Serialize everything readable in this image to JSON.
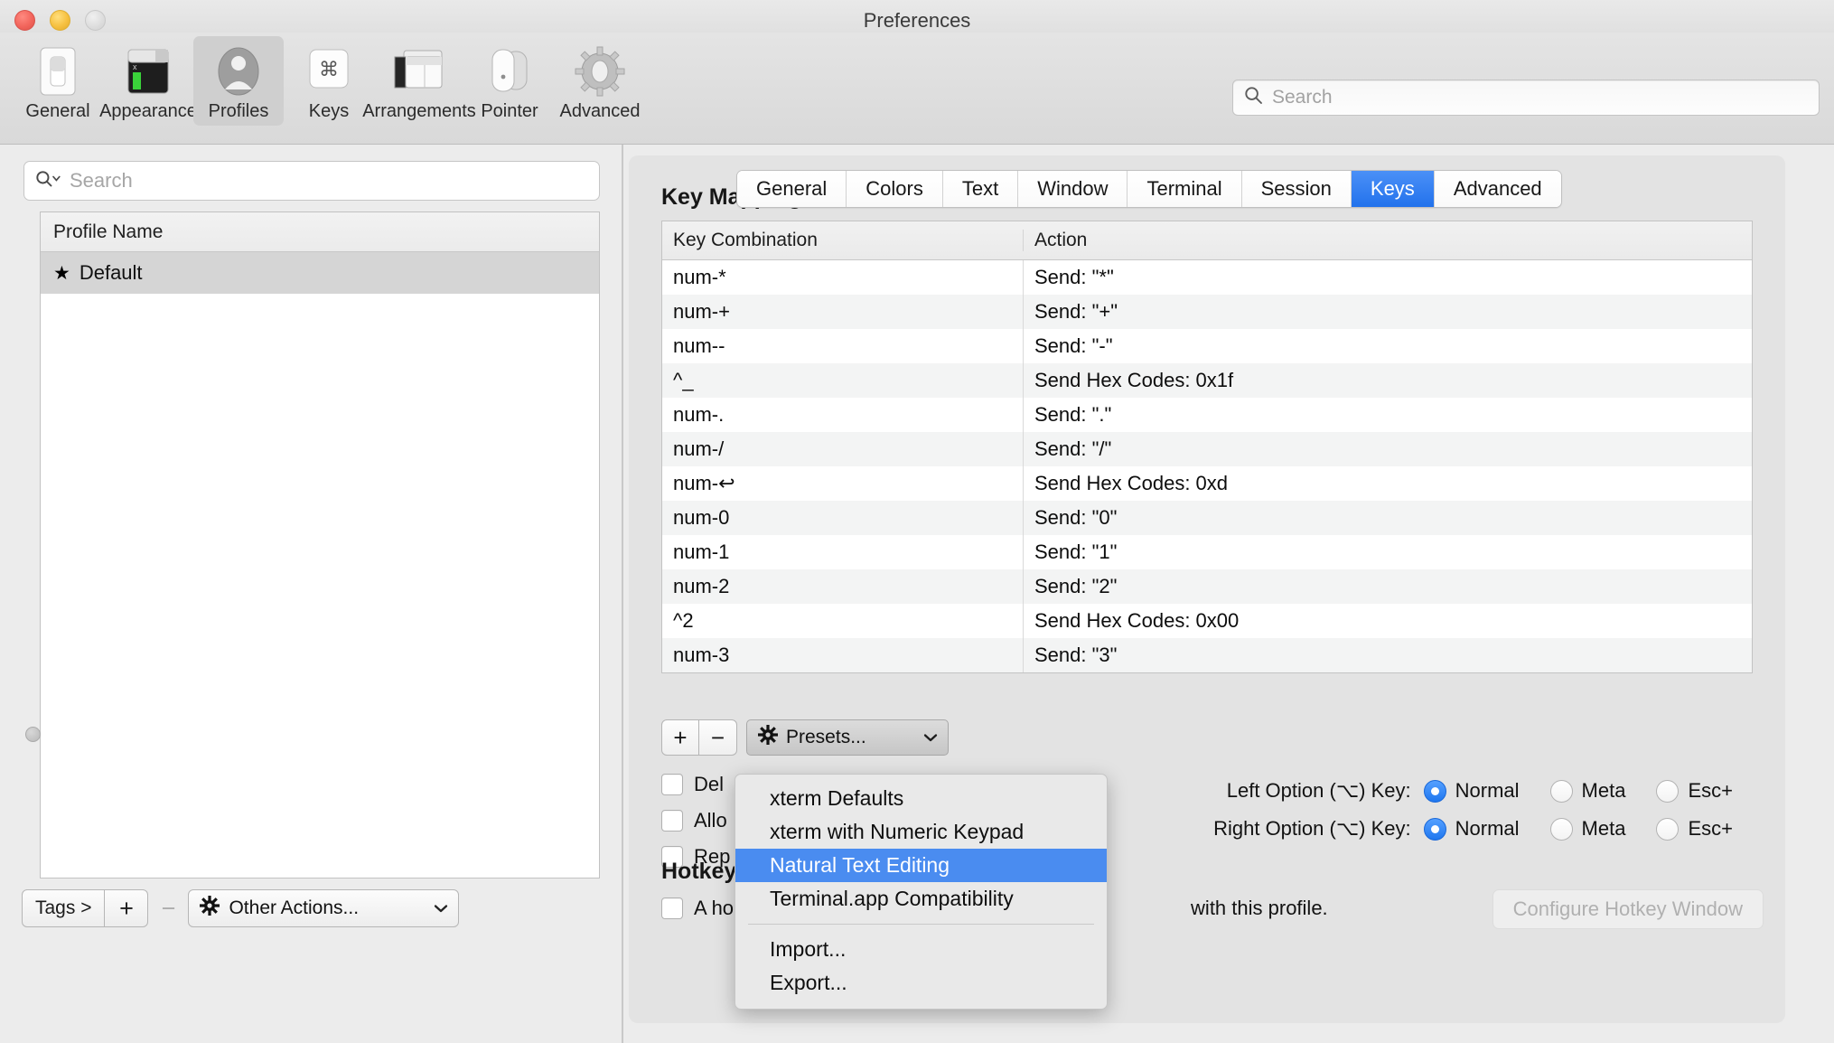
{
  "window": {
    "title": "Preferences",
    "traffic_lights": [
      "close-button",
      "minimize-button",
      "zoom-button"
    ]
  },
  "toolbar": {
    "items": [
      {
        "label": "General",
        "icon": "general-icon",
        "selected": false
      },
      {
        "label": "Appearance",
        "icon": "appearance-icon",
        "selected": false
      },
      {
        "label": "Profiles",
        "icon": "profiles-icon",
        "selected": true
      },
      {
        "label": "Keys",
        "icon": "keys-icon",
        "selected": false
      },
      {
        "label": "Arrangements",
        "icon": "arrangements-icon",
        "selected": false
      },
      {
        "label": "Pointer",
        "icon": "pointer-icon",
        "selected": false
      },
      {
        "label": "Advanced",
        "icon": "advanced-icon",
        "selected": false
      }
    ],
    "search": {
      "placeholder": "Search",
      "value": "",
      "icon": "search-icon"
    }
  },
  "sidebar": {
    "search": {
      "placeholder": "Search",
      "value": "",
      "icon": "search-scope-icon"
    },
    "table": {
      "header": "Profile Name",
      "rows": [
        {
          "name": "Default",
          "starred": true,
          "selected": true
        }
      ]
    },
    "bottom_bar": {
      "tags_label": "Tags >",
      "add_label": "+",
      "remove_label": "−",
      "other_actions_label": "Other Actions...",
      "gear_icon": "gear-icon",
      "chevron_icon": "chevron-down-icon"
    }
  },
  "tabs": [
    {
      "label": "General",
      "selected": false
    },
    {
      "label": "Colors",
      "selected": false
    },
    {
      "label": "Text",
      "selected": false
    },
    {
      "label": "Window",
      "selected": false
    },
    {
      "label": "Terminal",
      "selected": false
    },
    {
      "label": "Session",
      "selected": false
    },
    {
      "label": "Keys",
      "selected": true
    },
    {
      "label": "Advanced",
      "selected": false
    }
  ],
  "keys_pane": {
    "section_title": "Key Mappings",
    "table": {
      "columns": [
        "Key Combination",
        "Action"
      ],
      "rows": [
        {
          "combo": "num-*",
          "action": "Send: \"*\""
        },
        {
          "combo": "num-+",
          "action": "Send: \"+\""
        },
        {
          "combo": "num--",
          "action": "Send: \"-\""
        },
        {
          "combo": "^_",
          "action": "Send Hex Codes: 0x1f"
        },
        {
          "combo": "num-.",
          "action": "Send: \".\""
        },
        {
          "combo": "num-/",
          "action": "Send: \"/\""
        },
        {
          "combo": "num-↩",
          "action": "Send Hex Codes: 0xd"
        },
        {
          "combo": "num-0",
          "action": "Send: \"0\""
        },
        {
          "combo": "num-1",
          "action": "Send: \"1\""
        },
        {
          "combo": "num-2",
          "action": "Send: \"2\""
        },
        {
          "combo": "^2",
          "action": "Send Hex Codes: 0x00"
        },
        {
          "combo": "num-3",
          "action": "Send: \"3\""
        }
      ]
    },
    "tools": {
      "add_label": "+",
      "remove_label": "−",
      "presets_label": "Presets...",
      "gear_icon": "gear-icon",
      "chevron_icon": "chevron-down-icon"
    },
    "checkboxes": [
      {
        "label": "Del",
        "checked": false
      },
      {
        "label": "Allo",
        "checked": false
      },
      {
        "label": "Rep",
        "checked": false
      }
    ],
    "option_keys": [
      {
        "label": "Left Option (⌥) Key:",
        "choices": [
          {
            "label": "Normal",
            "selected": true
          },
          {
            "label": "Meta",
            "selected": false
          },
          {
            "label": "Esc+",
            "selected": false
          }
        ]
      },
      {
        "label": "Right Option (⌥) Key:",
        "choices": [
          {
            "label": "Normal",
            "selected": true
          },
          {
            "label": "Meta",
            "selected": false
          },
          {
            "label": "Esc+",
            "selected": false
          }
        ]
      }
    ],
    "hotkey": {
      "title": "Hotkey",
      "checkbox_label": "A ho",
      "trailing_text": "with this profile.",
      "configure_button": "Configure Hotkey Window",
      "configure_enabled": false
    }
  },
  "presets_menu": {
    "open": true,
    "items": [
      {
        "label": "xterm Defaults",
        "selected": false,
        "separator_after": false
      },
      {
        "label": "xterm with Numeric Keypad",
        "selected": false,
        "separator_after": false
      },
      {
        "label": "Natural Text Editing",
        "selected": true,
        "separator_after": false
      },
      {
        "label": "Terminal.app Compatibility",
        "selected": false,
        "separator_after": true
      },
      {
        "label": "Import...",
        "selected": false,
        "separator_after": false
      },
      {
        "label": "Export...",
        "selected": false,
        "separator_after": false
      }
    ]
  },
  "colors": {
    "accent_blue": "#2272ec",
    "menu_highlight": "#4a8cf0",
    "window_bg": "#ececec",
    "panel_bg": "#e3e3e3"
  }
}
